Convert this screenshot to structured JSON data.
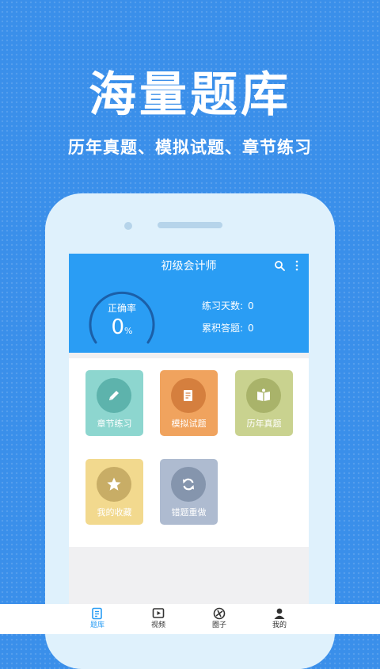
{
  "promo": {
    "headline": "海量题库",
    "subline": "历年真题、模拟试题、章节练习"
  },
  "app": {
    "title": "初级会计师",
    "accuracy_label": "正确率",
    "accuracy_value": "0",
    "accuracy_unit": "%",
    "stats": [
      {
        "label": "练习天数:",
        "value": "0"
      },
      {
        "label": "累积答题:",
        "value": "0"
      }
    ],
    "tiles": [
      {
        "label": "章节练习",
        "icon": "pencil-icon",
        "bg": "#8dd6cf",
        "circle": "#5db3ac"
      },
      {
        "label": "模拟试题",
        "icon": "document-icon",
        "bg": "#f0a35e",
        "circle": "#d57f3e"
      },
      {
        "label": "历年真题",
        "icon": "book-icon",
        "bg": "#c9d28f",
        "circle": "#a9b36a"
      },
      {
        "label": "我的收藏",
        "icon": "star-icon",
        "bg": "#f2d98e",
        "circle": "#c8ad66"
      },
      {
        "label": "错题重做",
        "icon": "refresh-icon",
        "bg": "#aebbd0",
        "circle": "#8595ad"
      }
    ],
    "nav": [
      {
        "label": "题库",
        "icon": "question-bank-icon",
        "active": true
      },
      {
        "label": "视频",
        "icon": "video-icon",
        "active": false
      },
      {
        "label": "圈子",
        "icon": "circle-community-icon",
        "active": false
      },
      {
        "label": "我的",
        "icon": "profile-icon",
        "active": false
      }
    ],
    "colors": {
      "primary": "#2a9df4",
      "background": "#3a8fea"
    }
  }
}
